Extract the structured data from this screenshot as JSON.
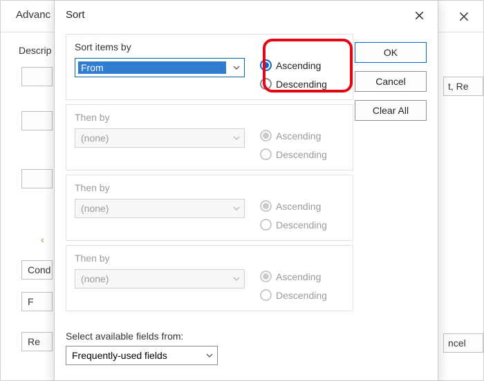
{
  "bg": {
    "title": "Advanc",
    "close": "×",
    "desc_label": "Descrip",
    "right_frag_top": "t, Re",
    "right_frag_bottom": "ncel",
    "left": {
      "cond": "Cond",
      "f": "F",
      "re": "Re"
    }
  },
  "sort": {
    "title": "Sort",
    "close": "×",
    "buttons": {
      "ok": "OK",
      "cancel": "Cancel",
      "clear_all": "Clear All"
    },
    "level1": {
      "label": "Sort items by",
      "field": "From",
      "asc": "Ascending",
      "desc": "Descending",
      "selected": "asc"
    },
    "level2": {
      "label": "Then by",
      "field": "(none)",
      "asc": "Ascending",
      "desc": "Descending"
    },
    "level3": {
      "label": "Then by",
      "field": "(none)",
      "asc": "Ascending",
      "desc": "Descending"
    },
    "level4": {
      "label": "Then by",
      "field": "(none)",
      "asc": "Ascending",
      "desc": "Descending"
    },
    "available": {
      "label": "Select available fields from:",
      "value": "Frequently-used fields"
    }
  }
}
